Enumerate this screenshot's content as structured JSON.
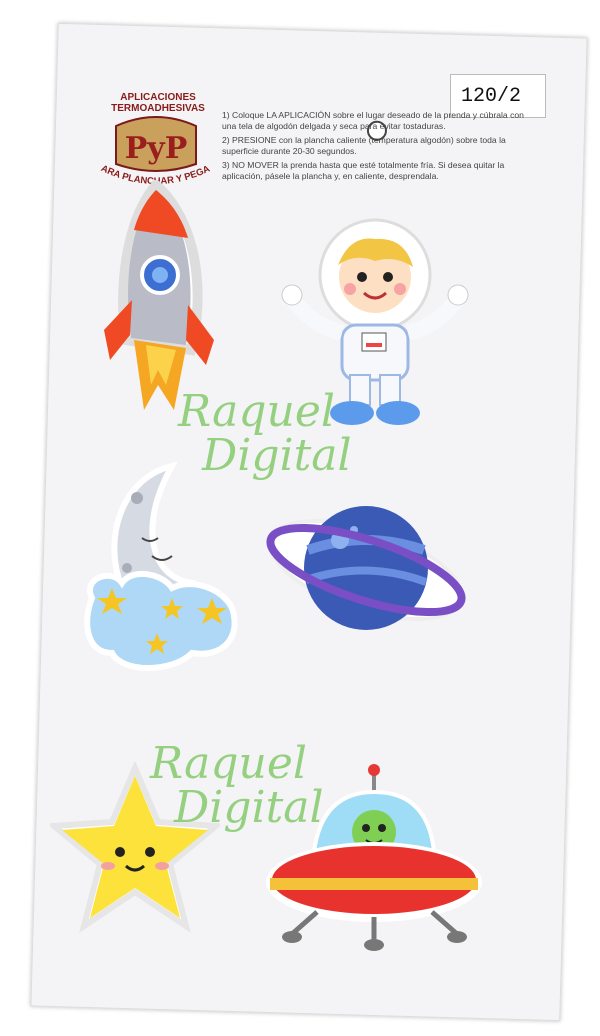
{
  "price_tag": "120/2",
  "brand": {
    "top_line_1": "APLICACIONES",
    "top_line_2": "TERMOADHESIVAS",
    "logo_text": "PyP",
    "tagline": "PARA PLANCHAR Y PEGAR"
  },
  "instructions": [
    "1) Coloque LA APLICACIÓN sobre el lugar deseado de la prenda y cúbrala con una tela de algodón delgada y seca para evitar tostaduras.",
    "2) PRESIONE con la plancha caliente (temperatura algodón) sobre toda la superficie durante 20-30 segundos.",
    "3) NO MOVER la prenda hasta que esté totalmente fría. Si desea quitar la aplicación, pásele la plancha y, en caliente, desprendala."
  ],
  "watermark": {
    "line1": "Raquel",
    "line2": "Digital"
  },
  "stickers": [
    "rocket",
    "astronaut",
    "moon",
    "planet",
    "star",
    "ufo"
  ],
  "colors": {
    "brand_red": "#8a1b1b",
    "watermark_green": "#76c45a"
  }
}
